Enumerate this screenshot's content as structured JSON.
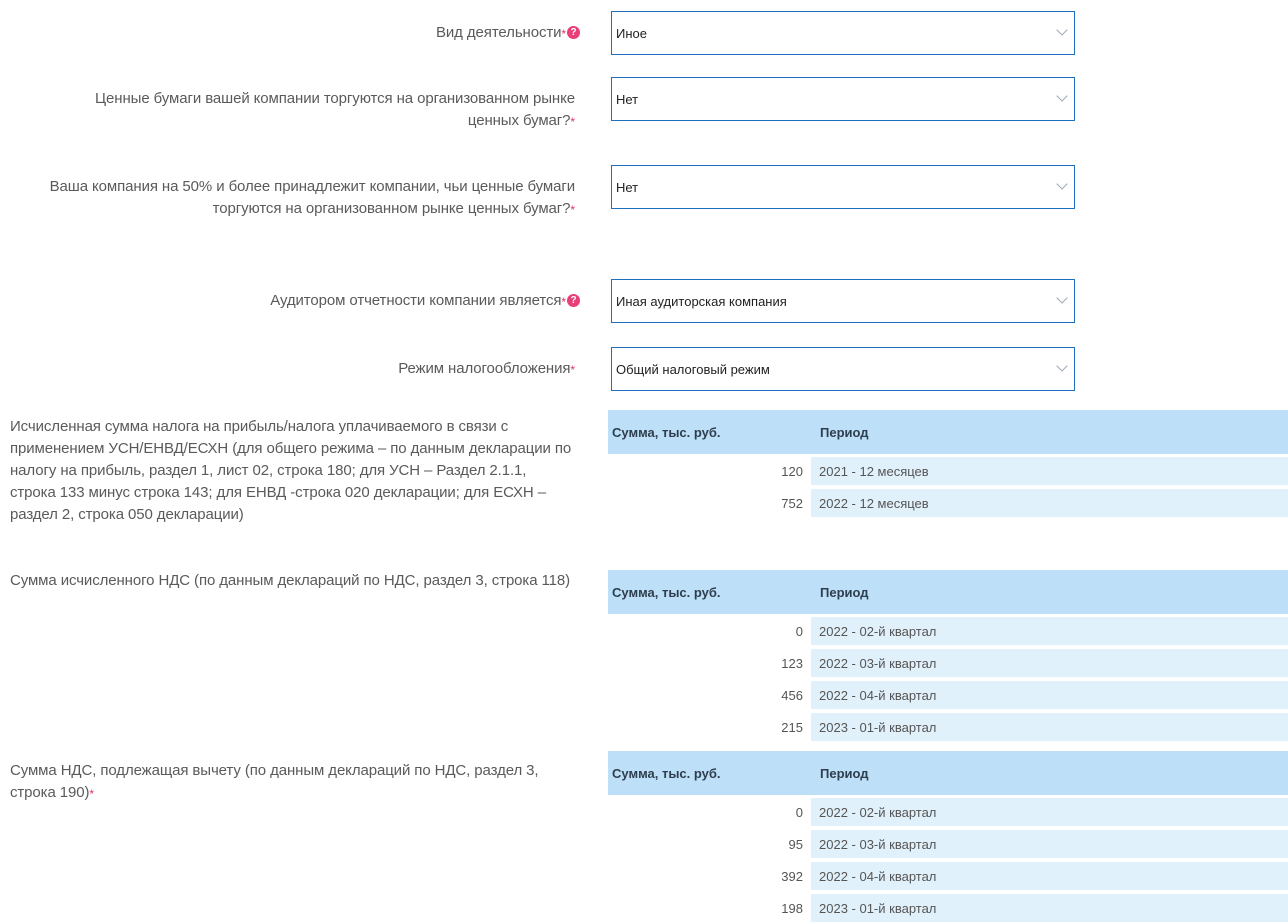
{
  "fields": [
    {
      "label": "Вид деятельности",
      "required": true,
      "help": true,
      "value": "Иное"
    },
    {
      "label": "Ценные бумаги вашей компании торгуются на организованном рынке ценных бумаг?",
      "required": true,
      "help": false,
      "value": "Нет"
    },
    {
      "label": "Ваша компания на 50% и более принадлежит компании, чьи ценные бумаги торгуются на организованном рынке ценных бумаг?",
      "required": true,
      "help": false,
      "value": "Нет"
    },
    {
      "label": "Аудитором отчетности компании является",
      "required": true,
      "help": true,
      "value": "Иная аудиторская компания"
    },
    {
      "label": "Режим налогообложения",
      "required": true,
      "help": false,
      "value": "Общий налоговый режим"
    }
  ],
  "required_mark": "*",
  "tables": [
    {
      "label": "Исчисленная сумма налога на прибыль/налога уплачиваемого в связи с применением УСН/ЕНВД/ЕСХН (для общего режима – по данным декларации по налогу на прибыль, раздел 1, лист 02, строка 180; для УСН – Раздел 2.1.1, строка 133 минус строка 143; для ЕНВД -строка 020 декларации; для ЕСХН – раздел 2, строка 050 декларации)",
      "required": false,
      "col_amount": "Сумма, тыс. руб.",
      "col_period": "Период",
      "rows": [
        {
          "amount": "120",
          "period": "2021 - 12 месяцев"
        },
        {
          "amount": "752",
          "period": "2022 - 12 месяцев"
        }
      ]
    },
    {
      "label": "Сумма исчисленного НДС (по данным деклараций по НДС, раздел 3, строка 118)",
      "required": false,
      "col_amount": "Сумма, тыс. руб.",
      "col_period": "Период",
      "rows": [
        {
          "amount": "0",
          "period": "2022 - 02-й квартал"
        },
        {
          "amount": "123",
          "period": "2022 - 03-й квартал"
        },
        {
          "amount": "456",
          "period": "2022 - 04-й квартал"
        },
        {
          "amount": "215",
          "period": "2023 - 01-й квартал"
        }
      ]
    },
    {
      "label": "Сумма НДС, подлежащая вычету (по данным деклараций по НДС, раздел 3, строка 190)",
      "required": true,
      "col_amount": "Сумма, тыс. руб.",
      "col_period": "Период",
      "rows": [
        {
          "amount": "0",
          "period": "2022 - 02-й квартал"
        },
        {
          "amount": "95",
          "period": "2022 - 03-й квартал"
        },
        {
          "amount": "392",
          "period": "2022 - 04-й квартал"
        },
        {
          "amount": "198",
          "period": "2023 - 01-й квартал"
        }
      ]
    }
  ]
}
